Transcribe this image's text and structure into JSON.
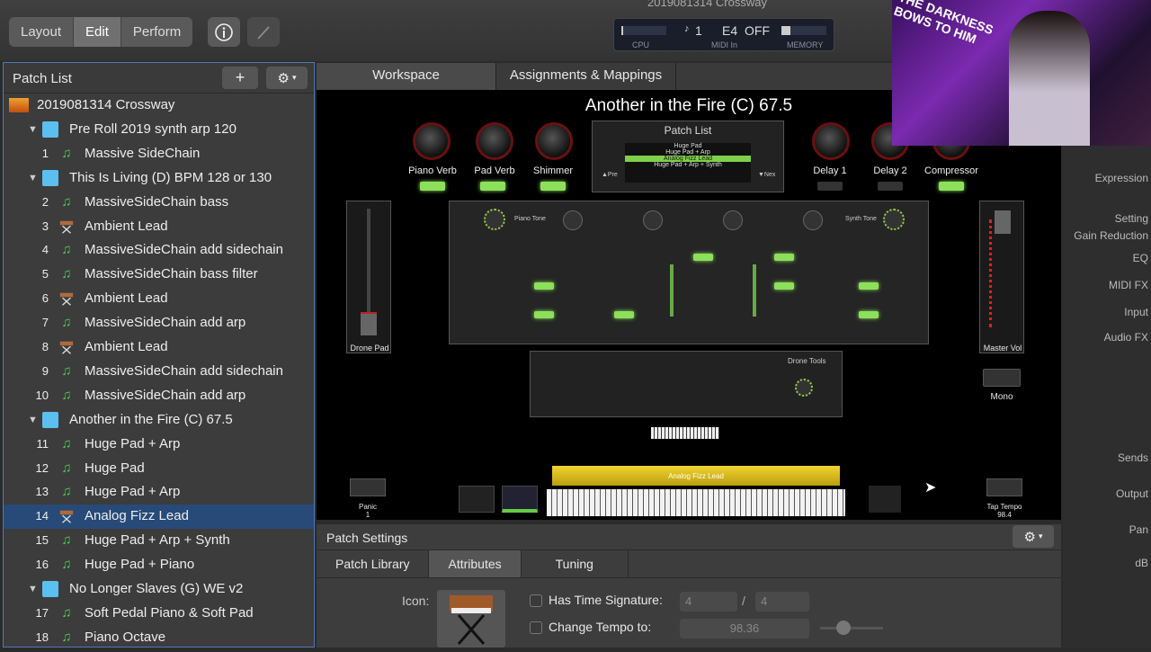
{
  "window_title": "2019081314 Crossway",
  "toolbar": {
    "modes": [
      {
        "label": "Layout"
      },
      {
        "label": "Edit",
        "active": true
      },
      {
        "label": "Perform"
      }
    ],
    "info_icon": "info-icon",
    "tuner_icon": "tuner-icon"
  },
  "lcd": {
    "cpu_label": "CPU",
    "midi_channel": "1",
    "midi_note": "E4",
    "midi_value": "OFF",
    "midi_label": "MIDI In",
    "memory_label": "MEMORY"
  },
  "patch_list": {
    "title": "Patch List",
    "add_label": "+",
    "rows": [
      {
        "type": "concert",
        "name": "2019081314 Crossway"
      },
      {
        "type": "set",
        "name": "Pre Roll 2019 synth arp 120"
      },
      {
        "type": "patch",
        "num": "1",
        "name": "Massive SideChain",
        "icon": "note"
      },
      {
        "type": "set",
        "name": "This Is Living (D) BPM 128 or 130"
      },
      {
        "type": "patch",
        "num": "2",
        "name": "MassiveSideChain bass",
        "icon": "note"
      },
      {
        "type": "patch",
        "num": "3",
        "name": "Ambient Lead",
        "icon": "keyboard"
      },
      {
        "type": "patch",
        "num": "4",
        "name": "MassiveSideChain add sidechain",
        "icon": "note"
      },
      {
        "type": "patch",
        "num": "5",
        "name": "MassiveSideChain bass filter",
        "icon": "note"
      },
      {
        "type": "patch",
        "num": "6",
        "name": "Ambient Lead",
        "icon": "keyboard"
      },
      {
        "type": "patch",
        "num": "7",
        "name": "MassiveSideChain add arp",
        "icon": "note"
      },
      {
        "type": "patch",
        "num": "8",
        "name": "Ambient Lead",
        "icon": "keyboard"
      },
      {
        "type": "patch",
        "num": "9",
        "name": "MassiveSideChain add sidechain",
        "icon": "note"
      },
      {
        "type": "patch",
        "num": "10",
        "name": "MassiveSideChain add arp",
        "icon": "note"
      },
      {
        "type": "set",
        "name": "Another in the Fire (C) 67.5"
      },
      {
        "type": "patch",
        "num": "11",
        "name": "Huge Pad + Arp",
        "icon": "note"
      },
      {
        "type": "patch",
        "num": "12",
        "name": "Huge Pad",
        "icon": "note"
      },
      {
        "type": "patch",
        "num": "13",
        "name": "Huge Pad + Arp",
        "icon": "note"
      },
      {
        "type": "patch",
        "num": "14",
        "name": "Analog Fizz Lead",
        "icon": "keyboard",
        "selected": true
      },
      {
        "type": "patch",
        "num": "15",
        "name": "Huge Pad + Arp + Synth",
        "icon": "note"
      },
      {
        "type": "patch",
        "num": "16",
        "name": "Huge Pad + Piano",
        "icon": "note"
      },
      {
        "type": "set",
        "name": "No Longer Slaves (G) WE v2"
      },
      {
        "type": "patch",
        "num": "17",
        "name": "Soft Pedal Piano & Soft Pad",
        "icon": "note"
      },
      {
        "type": "patch",
        "num": "18",
        "name": "Piano Octave",
        "icon": "note"
      }
    ]
  },
  "tabs": [
    {
      "label": "Workspace"
    },
    {
      "label": "Assignments & Mappings"
    }
  ],
  "stage": {
    "title": "Another in the Fire (C) 67.5",
    "knobs": [
      {
        "label": "Piano Verb"
      },
      {
        "label": "Pad Verb"
      },
      {
        "label": "Shimmer"
      },
      {
        "label": "Delay 1"
      },
      {
        "label": "Delay 2"
      },
      {
        "label": "Compressor"
      }
    ],
    "patch_list_widget": {
      "title": "Patch List",
      "items": [
        "Huge Pad",
        "Huge Pad + Arp",
        "Analog Fizz Lead",
        "Huge Pad + Arp + Synth"
      ],
      "prev": "▲Pre",
      "next": "▼Nex"
    },
    "drone_pad": "Drone Pad",
    "master_vol": "Master Vol",
    "mono": "Mono",
    "piano_tone": "Piano Tone",
    "synth_tone": "Synth Tone",
    "drone_tools": "Drone Tools",
    "analog_label": "Analog Fizz Lead",
    "panic": "Panic",
    "panic_value": "1",
    "tap_tempo": "Tap Tempo",
    "tap_value": "98.4"
  },
  "right_strip": [
    "Expression",
    "Setting",
    "Gain Reduction",
    "EQ",
    "MIDI FX",
    "Input",
    "Audio FX",
    "Sends",
    "Output",
    "Pan",
    "dB"
  ],
  "patch_settings": {
    "title": "Patch Settings",
    "tabs": [
      {
        "label": "Patch Library"
      },
      {
        "label": "Attributes",
        "active": true
      },
      {
        "label": "Tuning"
      }
    ],
    "icon_label": "Icon:",
    "time_sig_label": "Has Time Signature:",
    "time_sig_num": "4",
    "time_sig_sep": "/",
    "time_sig_den": "4",
    "tempo_label": "Change Tempo to:",
    "tempo_value": "98.36"
  },
  "webcam_text": "THE DARKNESS BOWS TO HIM"
}
